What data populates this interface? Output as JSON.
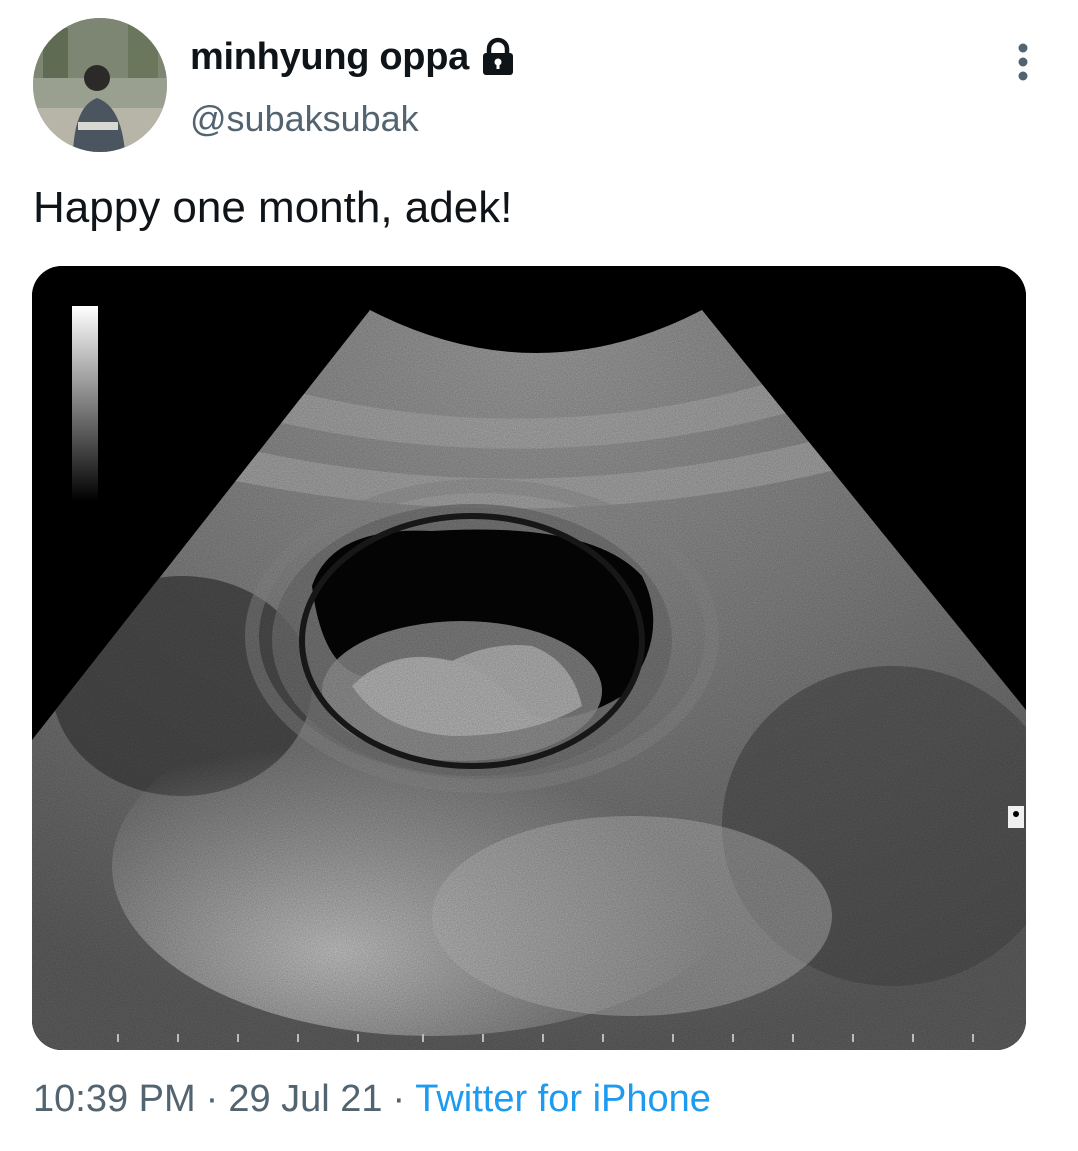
{
  "tweet": {
    "author": {
      "display_name": "minhyung oppa",
      "handle": "@subaksubak",
      "protected_icon": "lock-icon",
      "avatar_icon": "profile-photo"
    },
    "more_icon": "more-vertical-icon",
    "text": "Happy one month, adek!",
    "media": {
      "type": "image",
      "description_icon": "ultrasound-image"
    },
    "meta": {
      "time": "10:39 PM",
      "date": "29 Jul 21",
      "separator": "·",
      "source": "Twitter for iPhone"
    },
    "colors": {
      "text_primary": "#0f1419",
      "text_secondary": "#536471",
      "link": "#1d9bf0"
    }
  }
}
